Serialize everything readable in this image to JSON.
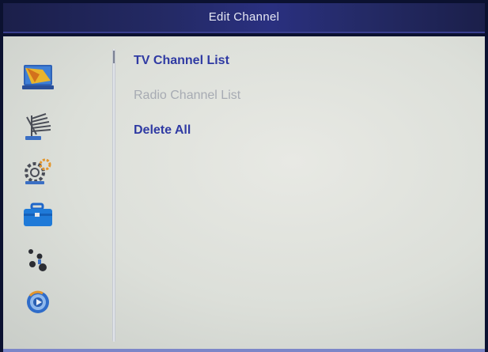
{
  "header": {
    "title": "Edit Channel"
  },
  "sidebar": {
    "icons": [
      {
        "name": "installation-icon"
      },
      {
        "name": "antenna-icon"
      },
      {
        "name": "settings-gear-icon"
      },
      {
        "name": "toolbox-icon"
      },
      {
        "name": "games-icon"
      },
      {
        "name": "media-icon"
      }
    ]
  },
  "menu": {
    "items": [
      {
        "label": "TV Channel List",
        "state": "focused"
      },
      {
        "label": "Radio Channel List",
        "state": "disabled"
      },
      {
        "label": "Delete All",
        "state": "normal"
      }
    ]
  },
  "colors": {
    "header_bg": "#242a66",
    "body_bg": "#e0e2dd",
    "menu_text": "#2f3aa3",
    "menu_disabled": "#a7abb3"
  }
}
